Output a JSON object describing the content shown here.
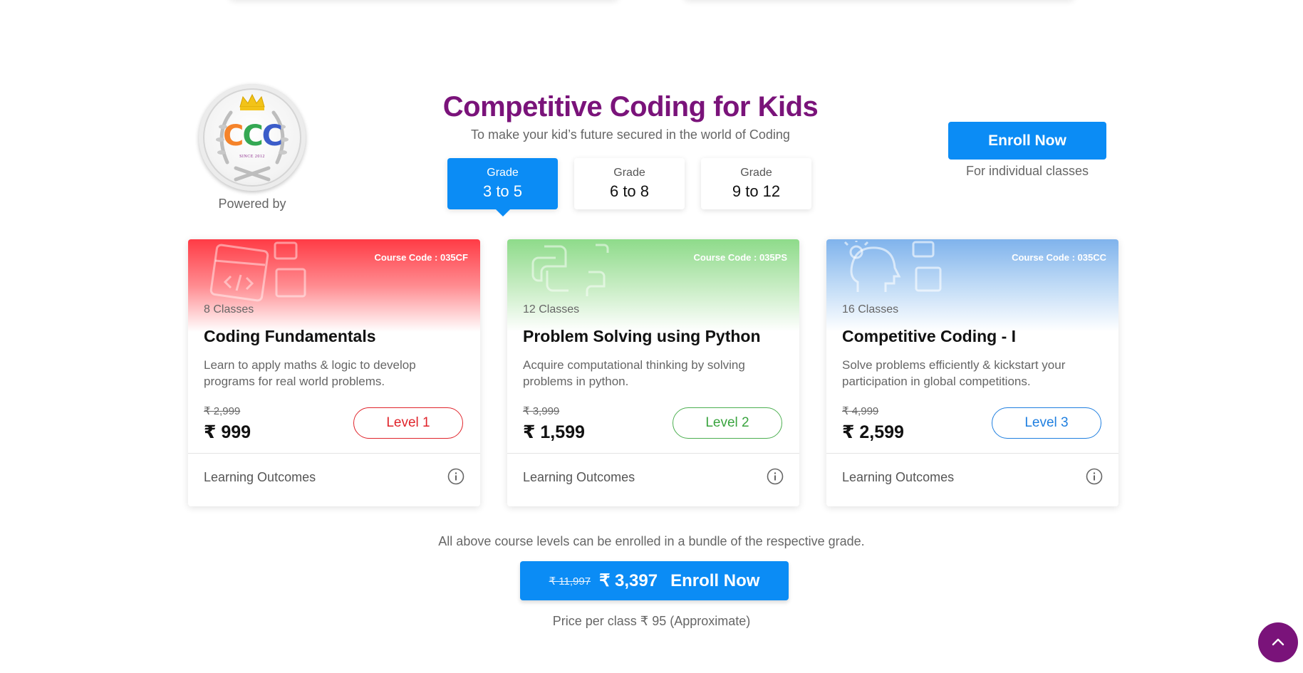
{
  "logo": {
    "letters": [
      "C",
      "C",
      "C"
    ],
    "since": "SINCE 2012",
    "powered_by": "Powered by"
  },
  "heading": {
    "title": "Competitive Coding for Kids",
    "subtitle": "To make your kid’s future secured in the world of Coding"
  },
  "grades": [
    {
      "label": "Grade",
      "range": "3 to 5",
      "active": true
    },
    {
      "label": "Grade",
      "range": "6 to 8",
      "active": false
    },
    {
      "label": "Grade",
      "range": "9 to 12",
      "active": false
    }
  ],
  "enroll_top": {
    "button": "Enroll Now",
    "note": "For individual classes"
  },
  "courses": [
    {
      "code": "Course Code : 035CF",
      "classes": "8 Classes",
      "title": "Coding Fundamentals",
      "description": "Learn to apply maths & logic to develop programs for real world problems.",
      "old_price": "₹ 2,999",
      "price": "₹ 999",
      "level": "Level 1",
      "outcomes": "Learning Outcomes",
      "theme": "red",
      "icon": "code-window-icon"
    },
    {
      "code": "Course Code : 035PS",
      "classes": "12 Classes",
      "title": "Problem Solving using Python",
      "description": "Acquire computational thinking by solving problems in python.",
      "old_price": "₹ 3,999",
      "price": "₹ 1,599",
      "level": "Level 2",
      "outcomes": "Learning Outcomes",
      "theme": "green",
      "icon": "python-logo-icon"
    },
    {
      "code": "Course Code : 035CC",
      "classes": "16 Classes",
      "title": "Competitive Coding - I",
      "description": "Solve problems efficiently & kickstart your participation in global competitions.",
      "old_price": "₹ 4,999",
      "price": "₹ 2,599",
      "level": "Level 3",
      "outcomes": "Learning Outcomes",
      "theme": "blue",
      "icon": "head-bulb-icon"
    }
  ],
  "bundle": {
    "note": "All above course levels can be enrolled in a bundle of the respective grade.",
    "old_price": "₹ 11,997",
    "price": "₹ 3,397",
    "button": "Enroll Now",
    "per_class": "Price per class ₹ 95 (Approximate)"
  },
  "colors": {
    "accent": "#0b8cf5",
    "brand": "#7a137a",
    "red": "#e0242b",
    "green": "#4caf50",
    "blue": "#1f7fe0"
  },
  "icons": {
    "info": "info-icon",
    "scroll_top": "chevron-up-icon",
    "crown": "crown-icon"
  }
}
